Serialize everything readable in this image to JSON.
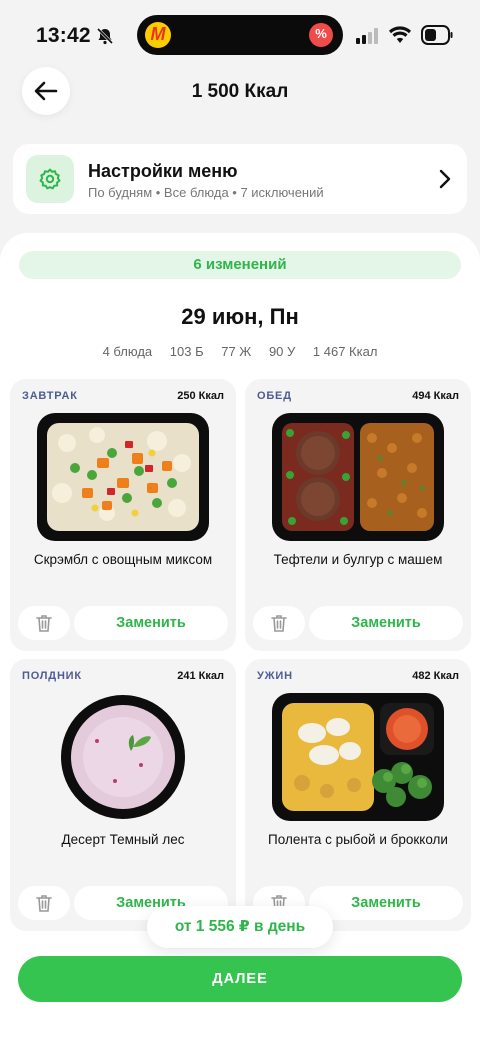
{
  "status_bar": {
    "time": "13:42",
    "app_badge_letter": "M"
  },
  "header": {
    "title": "1 500 Ккал"
  },
  "settings": {
    "title": "Настройки меню",
    "subtitle": "По будням • Все блюда • 7 исключений"
  },
  "changes": {
    "label": "6 изменений"
  },
  "day": {
    "title": "29 июн, Пн",
    "stats": [
      "4 блюда",
      "103 Б",
      "77 Ж",
      "90 У",
      "1 467 Ккал"
    ]
  },
  "meals": [
    {
      "type": "ЗАВТРАК",
      "kcal": "250 Ккал",
      "name": "Скрэмбл с овощным миксом",
      "replace_label": "Заменить"
    },
    {
      "type": "ОБЕД",
      "kcal": "494 Ккал",
      "name": "Тефтели и булгур с машем",
      "replace_label": "Заменить"
    },
    {
      "type": "ПОЛДНИК",
      "kcal": "241 Ккал",
      "name": "Десерт Темный лес",
      "replace_label": "Заменить"
    },
    {
      "type": "УЖИН",
      "kcal": "482 Ккал",
      "name": "Полента с рыбой и брокколи",
      "replace_label": "Заменить"
    }
  ],
  "price": {
    "label": "от 1 556 ₽ в день"
  },
  "footer": {
    "next_label": "ДАЛЕЕ"
  },
  "colors": {
    "accent": "#34c44f",
    "accent_text": "#2fb64b",
    "meal_type": "#4f5c94"
  }
}
